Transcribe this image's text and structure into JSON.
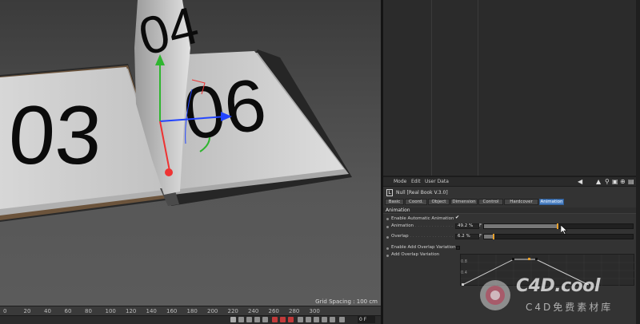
{
  "viewport": {
    "grid_spacing": "Grid Spacing : 100 cm",
    "left_page_number": "03",
    "right_page_number": "06",
    "flipping_page_number": "04",
    "ruler_ticks": [
      "0",
      "20",
      "40",
      "60",
      "80",
      "100",
      "120",
      "140",
      "160",
      "180",
      "200",
      "220",
      "240",
      "260",
      "280",
      "300"
    ],
    "frame_field": "0 F"
  },
  "attribute_manager": {
    "menu": [
      "Mode",
      "Edit",
      "User Data"
    ],
    "tool_icons": [
      "back-arrow-icon",
      "up-arrow-icon",
      "search-icon",
      "lock-icon",
      "new-window-icon",
      "dropdown-icon"
    ],
    "object_title": "Null [Real Book V.3.0]",
    "object_icon_letter": "L0",
    "tabs": [
      "Basic",
      "Coord.",
      "Object",
      "Dimension",
      "Control",
      "Hardcover",
      "Animation"
    ],
    "active_tab": "Animation",
    "section": "Animation",
    "props": {
      "enable_auto": {
        "label": "Enable Automatic Animation",
        "checked": true,
        "check_glyph": "✔"
      },
      "animation": {
        "label": "Animation",
        "value": "49.2 %",
        "unit": "F",
        "fraction": 0.492
      },
      "overlap": {
        "label": "Overlap",
        "value": "6.2 %",
        "unit": "F",
        "fraction": 0.062
      },
      "enable_overlap_var": {
        "label": "Enable Add Overlap Variation",
        "checked": false
      },
      "add_overlap_var": {
        "label": "Add Overlap Variation"
      }
    },
    "graph_labels": [
      "0.8",
      "0.4"
    ]
  },
  "watermark": {
    "text": "C4D.cool",
    "sub": "C4D免费素材库"
  },
  "colors": {
    "accent_tab": "#4a7fc2",
    "knob": "#e8a02c"
  }
}
